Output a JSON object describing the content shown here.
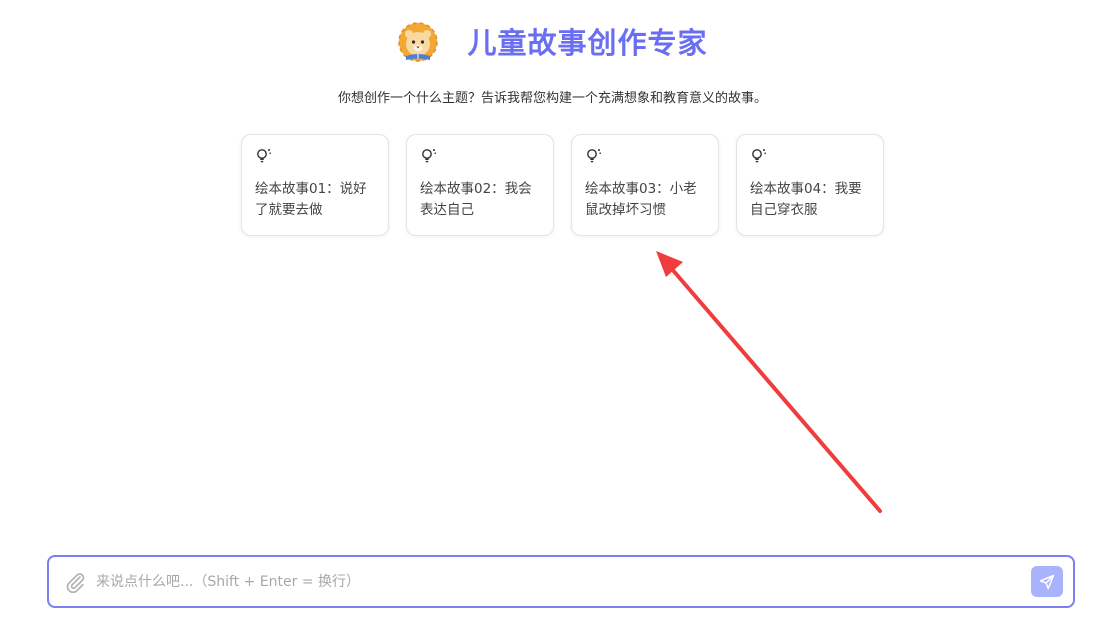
{
  "header": {
    "title": "儿童故事创作专家",
    "logo_icon": "lion-book-icon"
  },
  "subtitle": "你想创作一个什么主题？告诉我帮您构建一个充满想象和教育意义的故事。",
  "suggestions": [
    {
      "icon": "lightbulb-icon",
      "label": "绘本故事01：说好了就要去做"
    },
    {
      "icon": "lightbulb-icon",
      "label": "绘本故事02：我会表达自己"
    },
    {
      "icon": "lightbulb-icon",
      "label": "绘本故事03：小老鼠改掉坏习惯"
    },
    {
      "icon": "lightbulb-icon",
      "label": "绘本故事04：我要自己穿衣服"
    }
  ],
  "input": {
    "placeholder": "来说点什么吧...（Shift + Enter = 换行）",
    "value": "",
    "attach_icon": "paperclip-icon",
    "send_icon": "send-icon"
  },
  "colors": {
    "accent": "#6a6ef2",
    "input_border": "#7b7ff0",
    "send_button": "#a9b3fb",
    "annotation_arrow": "#ef3d3d"
  }
}
